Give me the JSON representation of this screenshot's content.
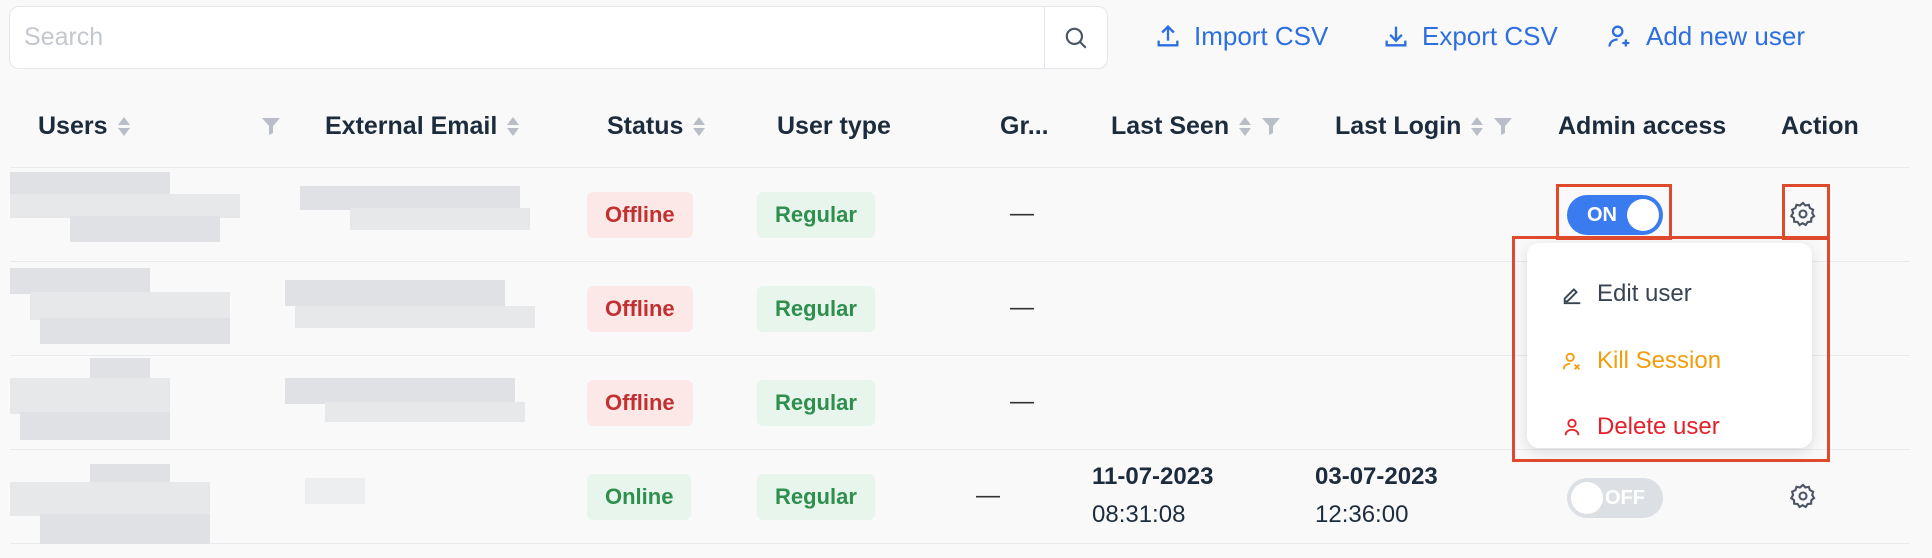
{
  "toolbar": {
    "search_placeholder": "Search",
    "import_label": "Import CSV",
    "export_label": "Export CSV",
    "add_label": "Add new user"
  },
  "columns": {
    "users": "Users",
    "external_email": "External Email",
    "status": "Status",
    "user_type": "User type",
    "groups": "Gr...",
    "last_seen": "Last Seen",
    "last_login": "Last Login",
    "admin_access": "Admin access",
    "action": "Action"
  },
  "rows": [
    {
      "status": "Offline",
      "user_type": "Regular",
      "groups": "—",
      "last_seen_date": "",
      "last_seen_time": "",
      "last_login_date": "",
      "last_login_time": "",
      "admin_access": "ON"
    },
    {
      "status": "Offline",
      "user_type": "Regular",
      "groups": "—",
      "last_seen_date": "",
      "last_seen_time": "",
      "last_login_date": "",
      "last_login_time": ""
    },
    {
      "status": "Offline",
      "user_type": "Regular",
      "groups": "—",
      "last_seen_date": "",
      "last_seen_time": "",
      "last_login_date": "",
      "last_login_time": ""
    },
    {
      "status": "Online",
      "user_type": "Regular",
      "groups": "—",
      "last_seen_date": "11-07-2023",
      "last_seen_time": "08:31:08",
      "last_login_date": "03-07-2023",
      "last_login_time": "12:36:00",
      "admin_access": "OFF"
    }
  ],
  "action_menu": {
    "edit": "Edit user",
    "kill": "Kill Session",
    "delete": "Delete user"
  },
  "colors": {
    "accent": "#2e6fe0",
    "toggle_on": "#3b7bf0",
    "kill_session": "#f29d0c",
    "delete_user": "#e5202b",
    "highlight": "#e04a2c"
  }
}
